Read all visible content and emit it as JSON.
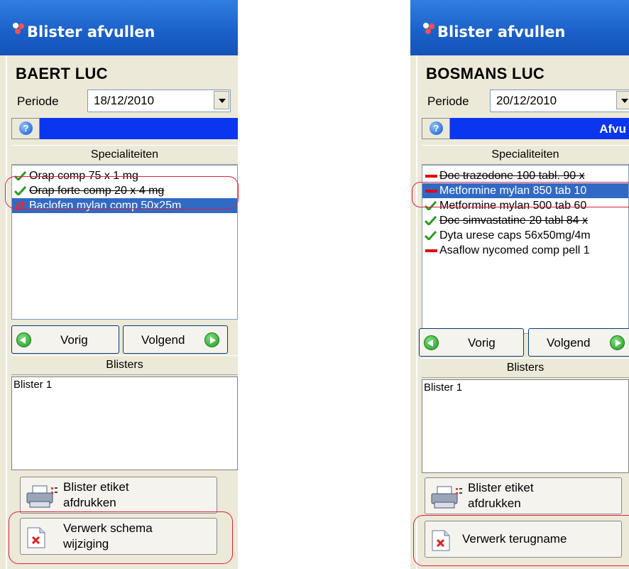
{
  "left": {
    "window_title": "Blister afvullen",
    "patient_name": "BAERT LUC",
    "period_label": "Periode",
    "period_value": "18/12/2010",
    "specialiteiten_header": "Specialiteiten",
    "specialiteiten": [
      {
        "label": "Orap comp  75 x 1 mg",
        "icon": "check-icon",
        "state": "normal"
      },
      {
        "label": "Orap forte comp  20 x 4 mg",
        "icon": "check-icon",
        "state": "strikethrough"
      },
      {
        "label": "Baclofen mylan comp 50x25m",
        "icon": "change-icon",
        "state": "selected"
      }
    ],
    "prev_label": "Vorig",
    "next_label": "Volgend",
    "blisters_header": "Blisters",
    "blisters": [
      "Blister 1"
    ],
    "print_button_line1": "Blister etiket",
    "print_button_line2": "afdrukken",
    "process_button_line1": "Verwerk schema",
    "process_button_line2": "wijziging"
  },
  "right": {
    "window_title": "Blister afvullen",
    "patient_name": "BOSMANS LUC",
    "period_label": "Periode",
    "period_value": "20/12/2010",
    "bar_text": "Afvu",
    "specialiteiten_header": "Specialiteiten",
    "specialiteiten": [
      {
        "label": "Doc trazodone 100 tabl. 90 x",
        "icon": "minus-icon",
        "state": "strikethrough"
      },
      {
        "label": "Metformine mylan 850 tab 10",
        "icon": "minus-icon",
        "state": "selected"
      },
      {
        "label": "Metformine mylan 500 tab  60",
        "icon": "check-icon",
        "state": "normal"
      },
      {
        "label": "Doc simvastatine 20 tabl 84 x",
        "icon": "check-icon",
        "state": "strikethrough"
      },
      {
        "label": "Dyta urese caps 56x50mg/4m",
        "icon": "check-icon",
        "state": "normal"
      },
      {
        "label": "Asaflow nycomed comp pell 1",
        "icon": "minus-icon",
        "state": "normal"
      }
    ],
    "prev_label": "Vorig",
    "next_label": "Volgend",
    "blisters_header": "Blisters",
    "blisters": [
      "Blister 1"
    ],
    "print_button_line1": "Blister etiket",
    "print_button_line2": "afdrukken",
    "process_button_line1": "Verwerk terugname"
  },
  "colors": {
    "titlebar": "#1a5fc8",
    "selection": "#316ac5",
    "accent_bar": "#0a36f0",
    "highlight_oval": "#e0203a",
    "check_green": "#2a9a1a",
    "minus_red": "#e00000"
  }
}
